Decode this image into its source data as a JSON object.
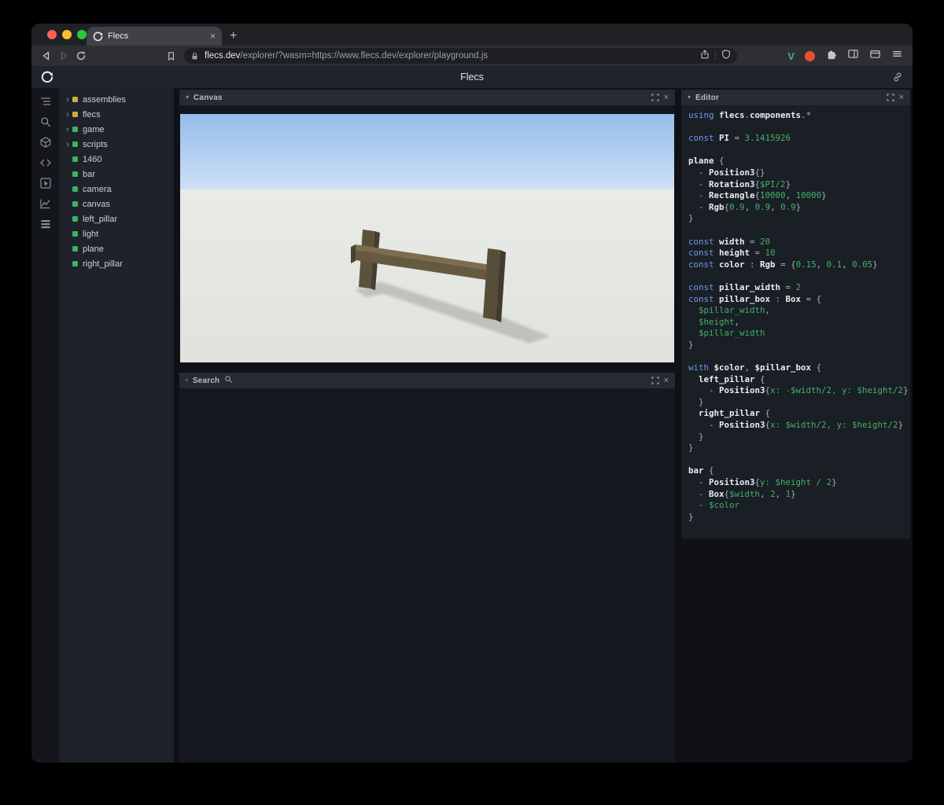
{
  "theme": {
    "kw": "#6f9bea",
    "ident": "#e9ecf1",
    "val": "#43b364",
    "plain": "#a9b0b9",
    "accent-green": "#3eb25c",
    "accent-yellow": "#d2ab3a"
  },
  "icons": {
    "close": "×",
    "add": "+",
    "chevron_down": "▾",
    "chevron_right": "›",
    "bullet": "•",
    "v_ext": "V"
  },
  "browser": {
    "tab_title": "Flecs",
    "url_domain": "flecs.dev",
    "url_path": "/explorer/?wasm=https://www.flecs.dev/explorer/playground.js"
  },
  "app": {
    "title": "Flecs"
  },
  "panels": {
    "canvas": "Canvas",
    "search": "Search",
    "editor": "Editor"
  },
  "tree": {
    "items": [
      {
        "label": "assemblies",
        "expandable": true,
        "color": "#d2ab3a"
      },
      {
        "label": "flecs",
        "expandable": true,
        "color": "#d2ab3a"
      },
      {
        "label": "game",
        "expandable": true,
        "color": "#3eb25c"
      },
      {
        "label": "scripts",
        "expandable": true,
        "color": "#3eb25c"
      },
      {
        "label": "1460",
        "expandable": false,
        "color": "#3eb25c"
      },
      {
        "label": "bar",
        "expandable": false,
        "color": "#3eb25c"
      },
      {
        "label": "camera",
        "expandable": false,
        "color": "#3eb25c"
      },
      {
        "label": "canvas",
        "expandable": false,
        "color": "#3eb25c"
      },
      {
        "label": "left_pillar",
        "expandable": false,
        "color": "#3eb25c"
      },
      {
        "label": "light",
        "expandable": false,
        "color": "#3eb25c"
      },
      {
        "label": "plane",
        "expandable": false,
        "color": "#3eb25c"
      },
      {
        "label": "right_pillar",
        "expandable": false,
        "color": "#3eb25c"
      }
    ]
  },
  "editor": {
    "lines": [
      [
        [
          "k",
          "using "
        ],
        [
          "i",
          "flecs"
        ],
        [
          "p",
          "."
        ],
        [
          "i",
          "components"
        ],
        [
          "p",
          ".*"
        ]
      ],
      [],
      [
        [
          "k",
          "const "
        ],
        [
          "i",
          "PI"
        ],
        [
          "p",
          " = "
        ],
        [
          "v",
          "3.1415926"
        ]
      ],
      [],
      [
        [
          "i",
          "plane"
        ],
        [
          "p",
          " {"
        ]
      ],
      [
        [
          "p",
          "  - "
        ],
        [
          "i",
          "Position3"
        ],
        [
          "p",
          "{}"
        ]
      ],
      [
        [
          "p",
          "  - "
        ],
        [
          "i",
          "Rotation3"
        ],
        [
          "p",
          "{"
        ],
        [
          "v",
          "$PI/2"
        ],
        [
          "p",
          "}"
        ]
      ],
      [
        [
          "p",
          "  - "
        ],
        [
          "i",
          "Rectangle"
        ],
        [
          "p",
          "{"
        ],
        [
          "v",
          "10000"
        ],
        [
          "p",
          ", "
        ],
        [
          "v",
          "10000"
        ],
        [
          "p",
          "}"
        ]
      ],
      [
        [
          "p",
          "  - "
        ],
        [
          "i",
          "Rgb"
        ],
        [
          "p",
          "{"
        ],
        [
          "v",
          "0.9"
        ],
        [
          "p",
          ", "
        ],
        [
          "v",
          "0.9"
        ],
        [
          "p",
          ", "
        ],
        [
          "v",
          "0.9"
        ],
        [
          "p",
          "}"
        ]
      ],
      [
        [
          "p",
          "}"
        ]
      ],
      [],
      [
        [
          "k",
          "const "
        ],
        [
          "i",
          "width"
        ],
        [
          "p",
          " = "
        ],
        [
          "v",
          "20"
        ]
      ],
      [
        [
          "k",
          "const "
        ],
        [
          "i",
          "height"
        ],
        [
          "p",
          " = "
        ],
        [
          "v",
          "10"
        ]
      ],
      [
        [
          "k",
          "const "
        ],
        [
          "i",
          "color"
        ],
        [
          "p",
          " : "
        ],
        [
          "i",
          "Rgb"
        ],
        [
          "p",
          " = {"
        ],
        [
          "v",
          "0.15"
        ],
        [
          "p",
          ", "
        ],
        [
          "v",
          "0.1"
        ],
        [
          "p",
          ", "
        ],
        [
          "v",
          "0.05"
        ],
        [
          "p",
          "}"
        ]
      ],
      [],
      [
        [
          "k",
          "const "
        ],
        [
          "i",
          "pillar_width"
        ],
        [
          "p",
          " = "
        ],
        [
          "v",
          "2"
        ]
      ],
      [
        [
          "k",
          "const "
        ],
        [
          "i",
          "pillar_box"
        ],
        [
          "p",
          " : "
        ],
        [
          "i",
          "Box"
        ],
        [
          "p",
          " = {"
        ]
      ],
      [
        [
          "p",
          "  "
        ],
        [
          "v",
          "$pillar_width"
        ],
        [
          "p",
          ","
        ]
      ],
      [
        [
          "p",
          "  "
        ],
        [
          "v",
          "$height"
        ],
        [
          "p",
          ","
        ]
      ],
      [
        [
          "p",
          "  "
        ],
        [
          "v",
          "$pillar_width"
        ]
      ],
      [
        [
          "p",
          "}"
        ]
      ],
      [],
      [
        [
          "k",
          "with "
        ],
        [
          "i",
          "$color"
        ],
        [
          "p",
          ", "
        ],
        [
          "i",
          "$pillar_box"
        ],
        [
          "p",
          " {"
        ]
      ],
      [
        [
          "p",
          "  "
        ],
        [
          "i",
          "left_pillar"
        ],
        [
          "p",
          " {"
        ]
      ],
      [
        [
          "p",
          "    - "
        ],
        [
          "i",
          "Position3"
        ],
        [
          "p",
          "{"
        ],
        [
          "v",
          "x: -$width/2, y: $height/2"
        ],
        [
          "p",
          "}"
        ]
      ],
      [
        [
          "p",
          "  }"
        ]
      ],
      [
        [
          "p",
          "  "
        ],
        [
          "i",
          "right_pillar"
        ],
        [
          "p",
          " {"
        ]
      ],
      [
        [
          "p",
          "    - "
        ],
        [
          "i",
          "Position3"
        ],
        [
          "p",
          "{"
        ],
        [
          "v",
          "x: $width/2, y: $height/2"
        ],
        [
          "p",
          "}"
        ]
      ],
      [
        [
          "p",
          "  }"
        ]
      ],
      [
        [
          "p",
          "}"
        ]
      ],
      [],
      [
        [
          "i",
          "bar"
        ],
        [
          "p",
          " {"
        ]
      ],
      [
        [
          "p",
          "  - "
        ],
        [
          "i",
          "Position3"
        ],
        [
          "p",
          "{"
        ],
        [
          "v",
          "y: $height / 2"
        ],
        [
          "p",
          "}"
        ]
      ],
      [
        [
          "p",
          "  - "
        ],
        [
          "i",
          "Box"
        ],
        [
          "p",
          "{"
        ],
        [
          "v",
          "$width"
        ],
        [
          "p",
          ", "
        ],
        [
          "v",
          "2"
        ],
        [
          "p",
          ", "
        ],
        [
          "v",
          "1"
        ],
        [
          "p",
          "}"
        ]
      ],
      [
        [
          "p",
          "  - "
        ],
        [
          "v",
          "$color"
        ]
      ],
      [
        [
          "p",
          "}"
        ]
      ]
    ]
  }
}
